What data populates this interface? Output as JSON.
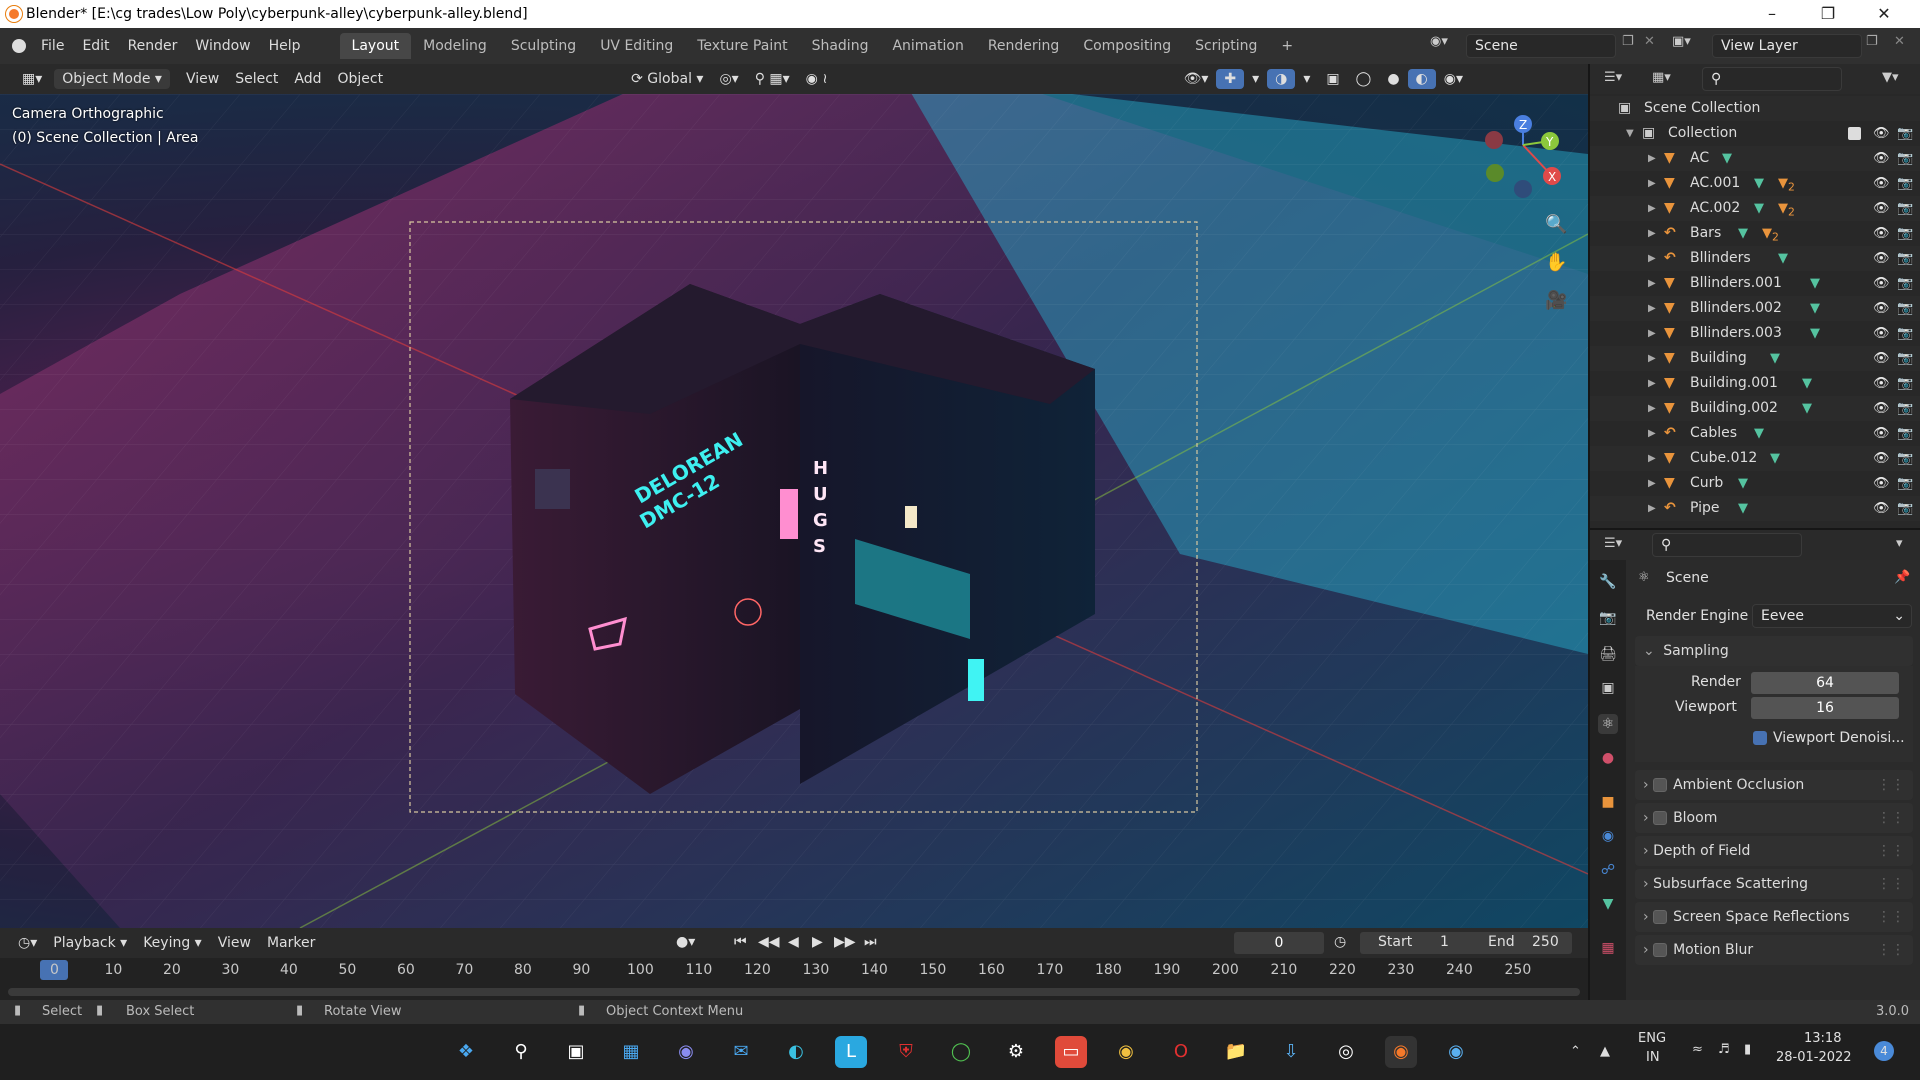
{
  "window": {
    "title": "Blender* [E:\\cg trades\\Low Poly\\cyberpunk-alley\\cyberpunk-alley.blend]"
  },
  "menus": [
    "File",
    "Edit",
    "Render",
    "Window",
    "Help"
  ],
  "workspaces": [
    "Layout",
    "Modeling",
    "Sculpting",
    "UV Editing",
    "Texture Paint",
    "Shading",
    "Animation",
    "Rendering",
    "Compositing",
    "Scripting",
    "+"
  ],
  "active_workspace": "Layout",
  "scene_field": "Scene",
  "view_layer_field": "View Layer",
  "viewport_header": {
    "mode": "Object Mode",
    "items": [
      "View",
      "Select",
      "Add",
      "Object"
    ],
    "transform": "Global"
  },
  "viewport": {
    "camera_label": "Camera Orthographic",
    "collection_label": "(0) Scene Collection | Area",
    "gizmo": {
      "x": "X",
      "y": "Y",
      "z": "Z"
    }
  },
  "outliner": {
    "root": "Scene Collection",
    "collection": "Collection",
    "items": [
      "AC",
      "AC.001",
      "AC.002",
      "Bars",
      "Bllinders",
      "Bllinders.001",
      "Bllinders.002",
      "Bllinders.003",
      "Building",
      "Building.001",
      "Building.002",
      "Cables",
      "Cube.012",
      "Curb",
      "Pipe"
    ],
    "item_kinds": [
      "mesh",
      "mesh",
      "mesh",
      "curve",
      "curve",
      "mesh",
      "mesh",
      "mesh",
      "mesh",
      "mesh",
      "mesh",
      "curve",
      "mesh",
      "mesh",
      "curve"
    ],
    "mod_counts": [
      "",
      "2",
      "2",
      "2",
      "",
      "",
      "",
      "",
      "",
      "",
      "",
      "",
      "",
      "",
      ""
    ]
  },
  "properties": {
    "context": "Scene",
    "render_engine_label": "Render Engine",
    "render_engine": "Eevee",
    "sampling": "Sampling",
    "render_label": "Render",
    "render_value": "64",
    "viewport_label": "Viewport",
    "viewport_value": "16",
    "denoise_label": "Viewport Denoisi...",
    "panels": [
      "Ambient Occlusion",
      "Bloom",
      "Depth of Field",
      "Subsurface Scattering",
      "Screen Space Reflections",
      "Motion Blur"
    ]
  },
  "timeline": {
    "items": [
      "Playback",
      "Keying",
      "View",
      "Marker"
    ],
    "current_frame": "0",
    "start_label": "Start",
    "start": "1",
    "end_label": "End",
    "end": "250",
    "ticks": [
      "0",
      "10",
      "20",
      "30",
      "40",
      "50",
      "60",
      "70",
      "80",
      "90",
      "100",
      "110",
      "120",
      "130",
      "140",
      "150",
      "160",
      "170",
      "180",
      "190",
      "200",
      "210",
      "220",
      "230",
      "240",
      "250"
    ]
  },
  "statusbar": {
    "select": "Select",
    "box_select": "Box Select",
    "rotate": "Rotate View",
    "context_menu": "Object Context Menu",
    "version": "3.0.0"
  },
  "taskbar": {
    "lang1": "ENG",
    "lang2": "IN",
    "time": "13:18",
    "date": "28-01-2022",
    "notif": "4"
  },
  "scene_text": {
    "sign1": "DELOREAN",
    "sign2": "DMC-12",
    "hugs": "HUGS"
  },
  "colors": {
    "accent": "#4772b3",
    "orange": "#e9943c",
    "teal": "#55c3a0",
    "neon_pink": "#ff5fb0",
    "neon_cyan": "#3ef0f0"
  }
}
